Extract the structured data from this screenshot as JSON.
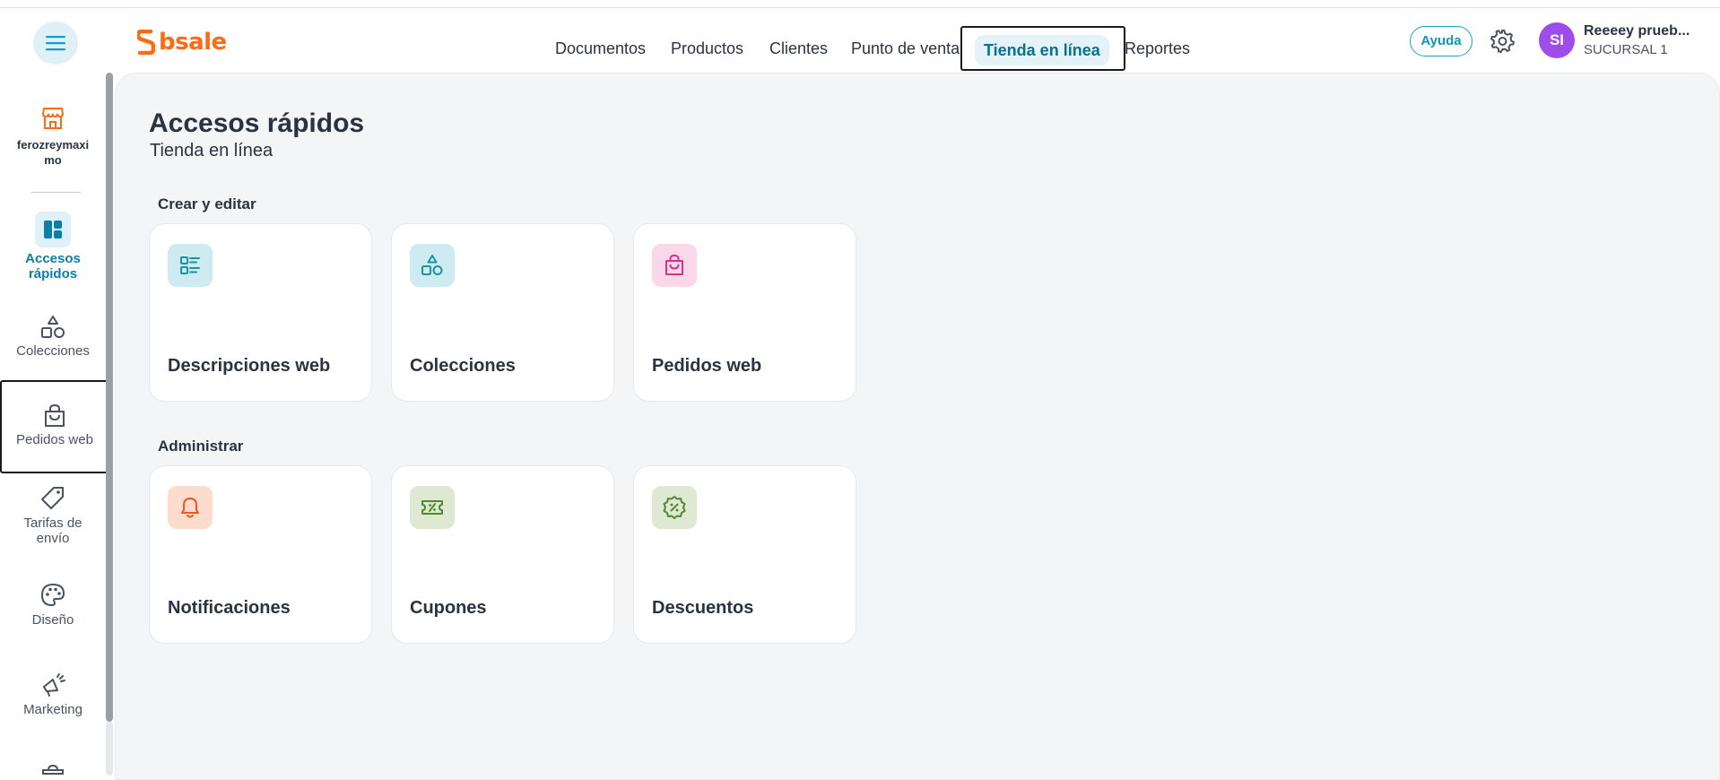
{
  "header": {
    "logo_text": "bsale",
    "nav": [
      {
        "label": "Documentos"
      },
      {
        "label": "Productos"
      },
      {
        "label": "Clientes"
      },
      {
        "label": "Punto de venta"
      },
      {
        "label": "Tienda en línea"
      },
      {
        "label": "Reportes"
      }
    ],
    "help_label": "Ayuda",
    "avatar_initials": "SI",
    "user_name": "Reeeey prueb...",
    "user_branch": "SUCURSAL 1"
  },
  "sidebar": {
    "store_name": "ferozreymaximo",
    "store_name_line1": "ferozreymaxi",
    "store_name_line2": "mo",
    "items": [
      {
        "line1": "Accesos",
        "line2": "rápidos"
      },
      {
        "line1": "Colecciones"
      },
      {
        "line1": "Pedidos web"
      },
      {
        "line1": "Tarifas de",
        "line2": "envío"
      },
      {
        "line1": "Diseño"
      },
      {
        "line1": "Marketing"
      }
    ]
  },
  "main": {
    "title": "Accesos rápidos",
    "subtitle": "Tienda en línea",
    "sections": [
      {
        "title": "Crear y editar",
        "cards": [
          {
            "label": "Descripciones web",
            "icon": "list-icon",
            "color": "#1793a8"
          },
          {
            "label": "Colecciones",
            "icon": "shapes-icon",
            "color": "#1793a8"
          },
          {
            "label": "Pedidos web",
            "icon": "shopping-bag-icon",
            "color": "#d63384"
          }
        ]
      },
      {
        "title": "Administrar",
        "cards": [
          {
            "label": "Notificaciones",
            "icon": "bell-icon",
            "color": "#f0561f"
          },
          {
            "label": "Cupones",
            "icon": "ticket-icon",
            "color": "#4f8a2b"
          },
          {
            "label": "Descuentos",
            "icon": "discount-badge-icon",
            "color": "#4f8a2b"
          }
        ]
      }
    ]
  },
  "colors": {
    "brand": "#ff6a13",
    "accent": "#1494b8",
    "active_nav_bg": "#e4f3f8",
    "avatar": "#9c4dea"
  }
}
